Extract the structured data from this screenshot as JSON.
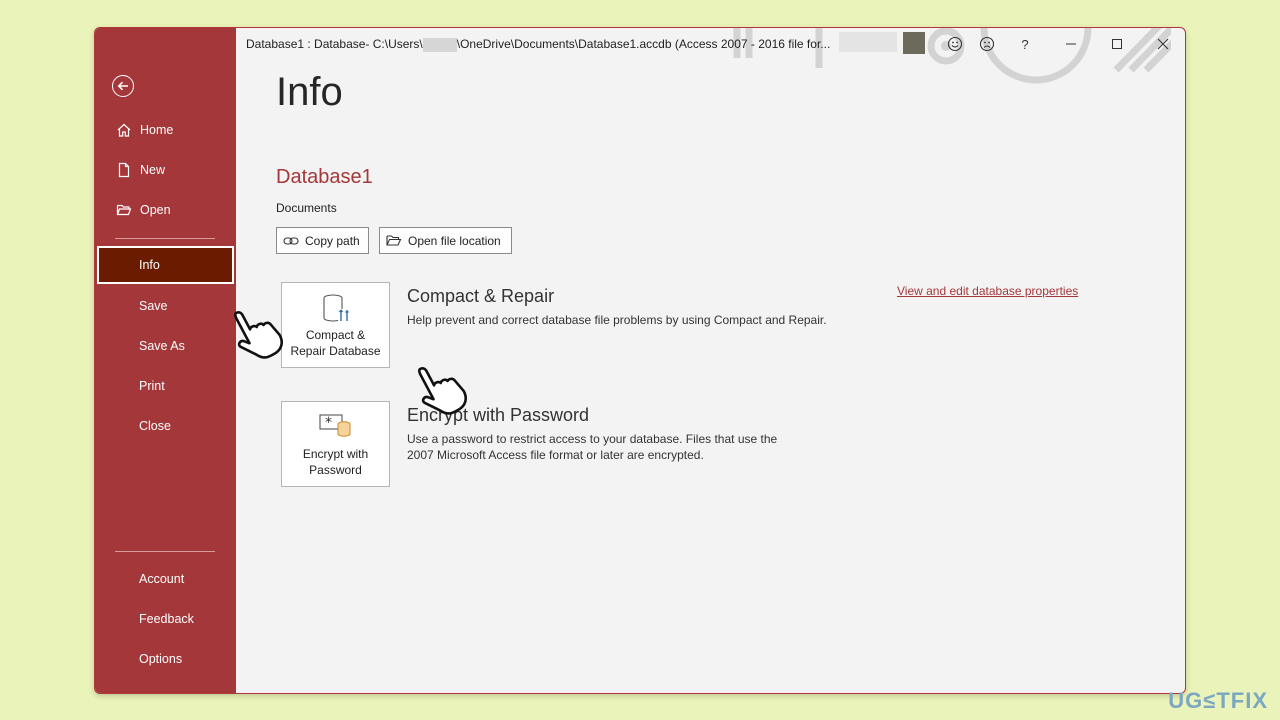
{
  "window": {
    "title_prefix": "Database1 : Database- C:\\Users\\",
    "title_suffix": "\\OneDrive\\Documents\\Database1.accdb (Access 2007 - 2016 file for..."
  },
  "sidebar": {
    "items": [
      {
        "label": "Home",
        "icon": "home-icon"
      },
      {
        "label": "New",
        "icon": "new-document-icon"
      },
      {
        "label": "Open",
        "icon": "open-folder-icon"
      },
      {
        "label": "Info"
      },
      {
        "label": "Save"
      },
      {
        "label": "Save As"
      },
      {
        "label": "Print"
      },
      {
        "label": "Close"
      },
      {
        "label": "Account"
      },
      {
        "label": "Feedback"
      },
      {
        "label": "Options"
      }
    ],
    "active": "Info"
  },
  "main": {
    "title": "Info",
    "db_name": "Database1",
    "db_location": "Documents",
    "copy_path_label": "Copy path",
    "open_location_label": "Open file location",
    "compact": {
      "button_line1": "Compact &",
      "button_line2": "Repair Database",
      "title": "Compact & Repair",
      "description": "Help prevent and correct database file problems by using Compact and Repair."
    },
    "encrypt": {
      "button_line1": "Encrypt with",
      "button_line2": "Password",
      "title": "Encrypt with Password",
      "description": "Use a password to restrict access to your database. Files that use the 2007 Microsoft Access file format or later are encrypted."
    },
    "properties_link": "View and edit database properties"
  },
  "titlebar_controls": {
    "help": "?"
  },
  "watermark": "UG≤TFIX",
  "colors": {
    "accent": "#a4373a",
    "active_nav": "#6b1c00",
    "background": "#f3f3f3",
    "page_bg": "#eaf3b9"
  }
}
